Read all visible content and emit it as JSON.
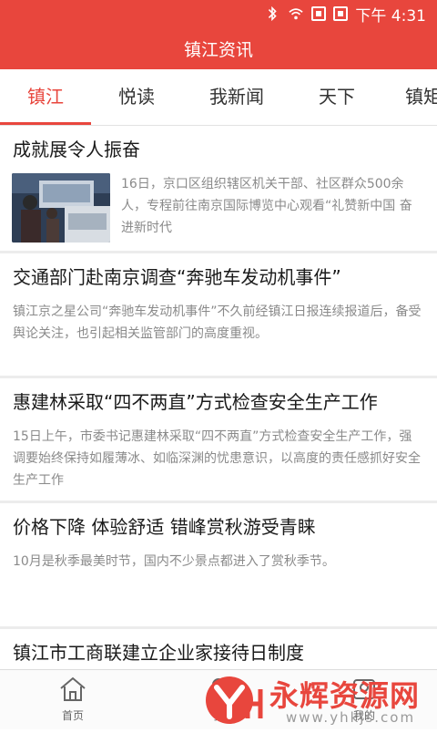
{
  "status_bar": {
    "time": "下午 4:31",
    "icons": [
      "bluetooth-icon",
      "wifi-icon",
      "sim1-icon",
      "sim2-icon"
    ],
    "background": "#e8463d"
  },
  "app_bar": {
    "title": "镇江资讯"
  },
  "tabs": [
    {
      "label": "镇江",
      "active": true
    },
    {
      "label": "悦读",
      "active": false
    },
    {
      "label": "我新闻",
      "active": false
    },
    {
      "label": "天下",
      "active": false
    },
    {
      "label": "镇矩",
      "active": false
    }
  ],
  "articles": [
    {
      "title": "成就展令人振奋",
      "summary": "16日，京口区组织辖区机关干部、社区群众500余人，专程前往南京国际博览中心观看“礼赞新中国 奋进新时代",
      "has_thumbnail": true
    },
    {
      "title": "交通部门赴南京调查“奔驰车发动机事件”",
      "summary": "镇江京之星公司“奔驰车发动机事件”不久前经镇江日报连续报道后，备受舆论关注，也引起相关监管部门的高度重视。",
      "has_thumbnail": false
    },
    {
      "title": "惠建林采取“四不两直”方式检查安全生产工作",
      "summary": "15日上午，市委书记惠建林采取“四不两直”方式检查安全生产工作，强调要始终保持如履薄冰、如临深渊的忧患意识，以高度的责任感抓好安全生产工作",
      "has_thumbnail": false
    },
    {
      "title": "价格下降 体验舒适 错峰赏秋游受青睐",
      "summary": "10月是秋季最美时节，国内不少景点都进入了赏秋季节。",
      "has_thumbnail": false
    },
    {
      "title": "镇江市工商联建立企业家接待日制度",
      "summary": "",
      "has_thumbnail": false
    }
  ],
  "bottom_nav": [
    {
      "label": "首页",
      "icon": "home-icon"
    },
    {
      "label": "我",
      "icon": "person-icon"
    },
    {
      "label": "我的",
      "icon": "profile-icon"
    }
  ],
  "watermark": {
    "brand": "永辉资源网",
    "url": "www.yhkjs.com"
  },
  "colors": {
    "accent": "#e8463d",
    "title_text": "#1a1a1a",
    "summary_text": "#8a8a8a"
  }
}
